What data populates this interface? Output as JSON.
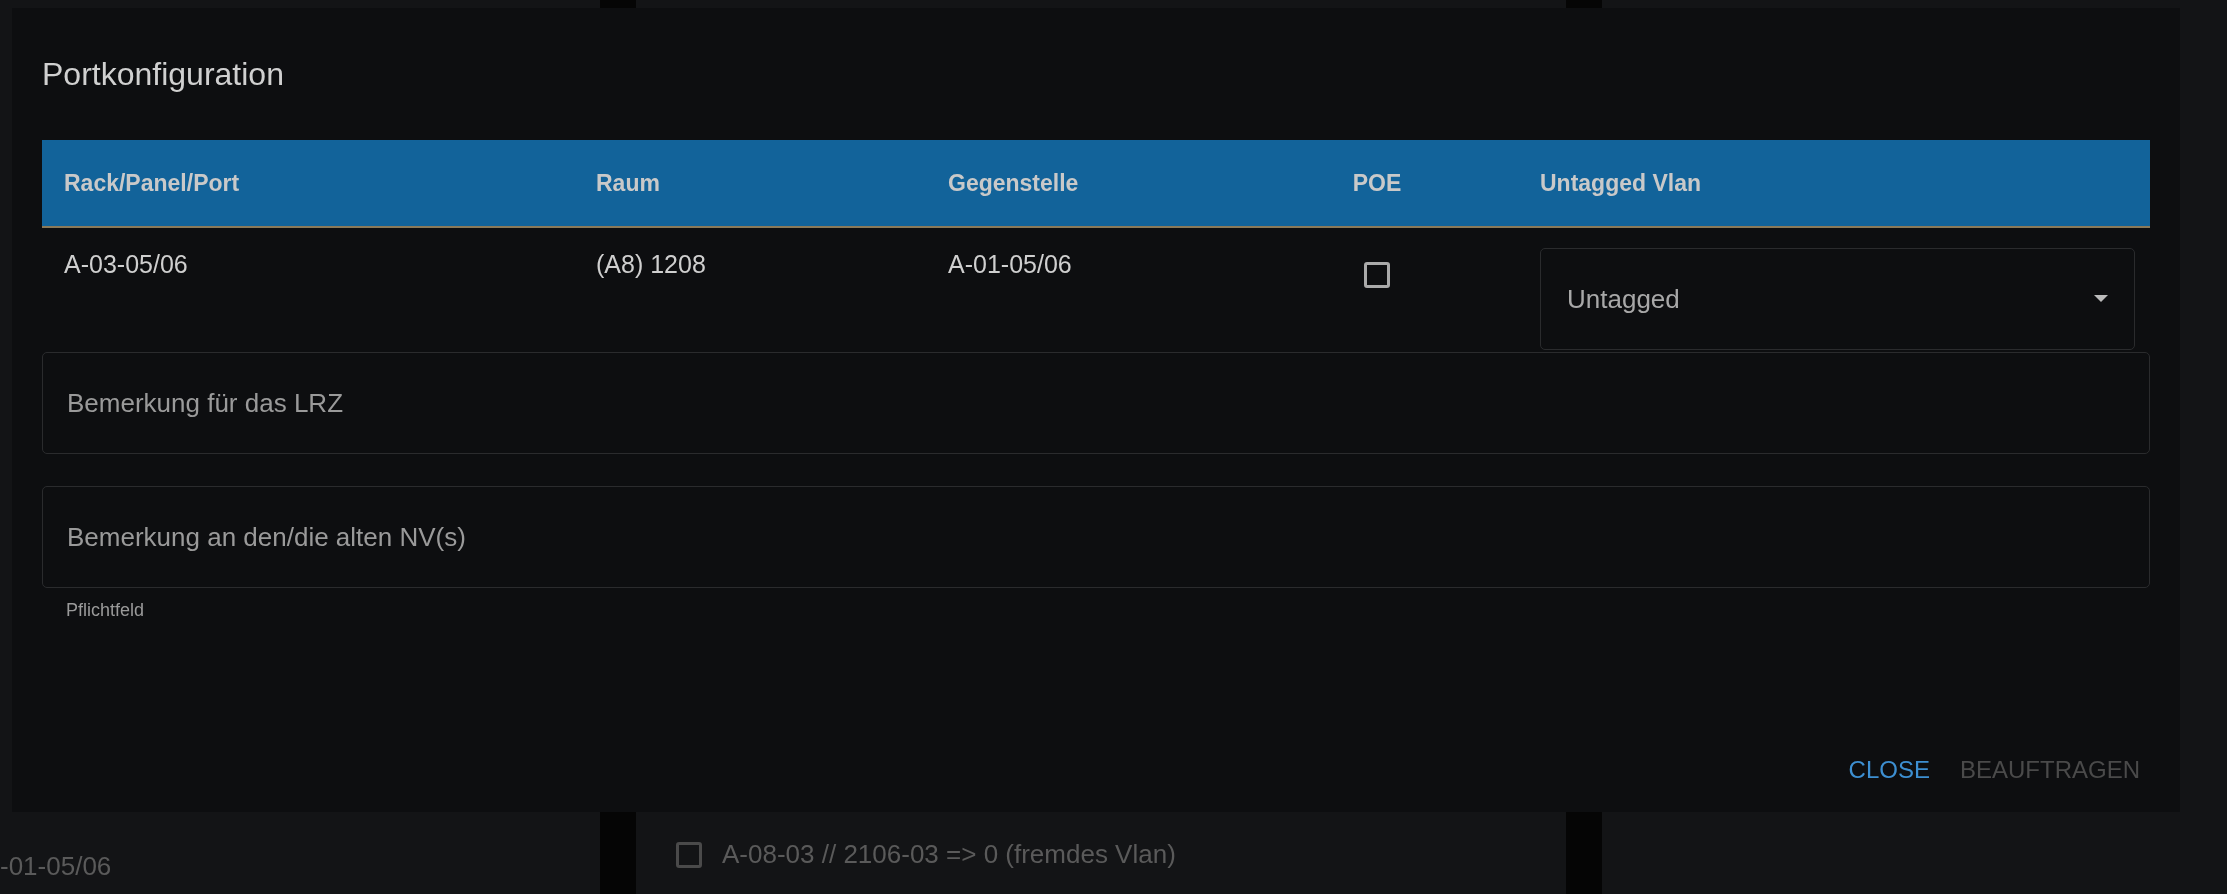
{
  "background": {
    "left_text": "-01-05/06",
    "items": [
      {
        "label": "A-08-03 // 2106-03 => 0 (fremdes Vlan)",
        "checked": false
      }
    ]
  },
  "dialog": {
    "title": "Portkonfiguration",
    "table": {
      "columns": [
        "Rack/Panel/Port",
        "Raum",
        "Gegenstelle",
        "POE",
        "Untagged Vlan"
      ],
      "rows": [
        {
          "rack_panel_port": "A-03-05/06",
          "raum": "(A8) 1208",
          "gegenstelle": "A-01-05/06",
          "poe_checked": false,
          "untagged_vlan": "Untagged"
        }
      ]
    },
    "fields": [
      {
        "placeholder": "Bemerkung für das LRZ"
      },
      {
        "placeholder": "Bemerkung an den/die alten NV(s)",
        "hint": "Pflichtfeld"
      }
    ],
    "buttons": [
      {
        "label": "CLOSE",
        "disabled": false
      },
      {
        "label": "BEAUFTRAGEN",
        "disabled": true
      }
    ]
  }
}
